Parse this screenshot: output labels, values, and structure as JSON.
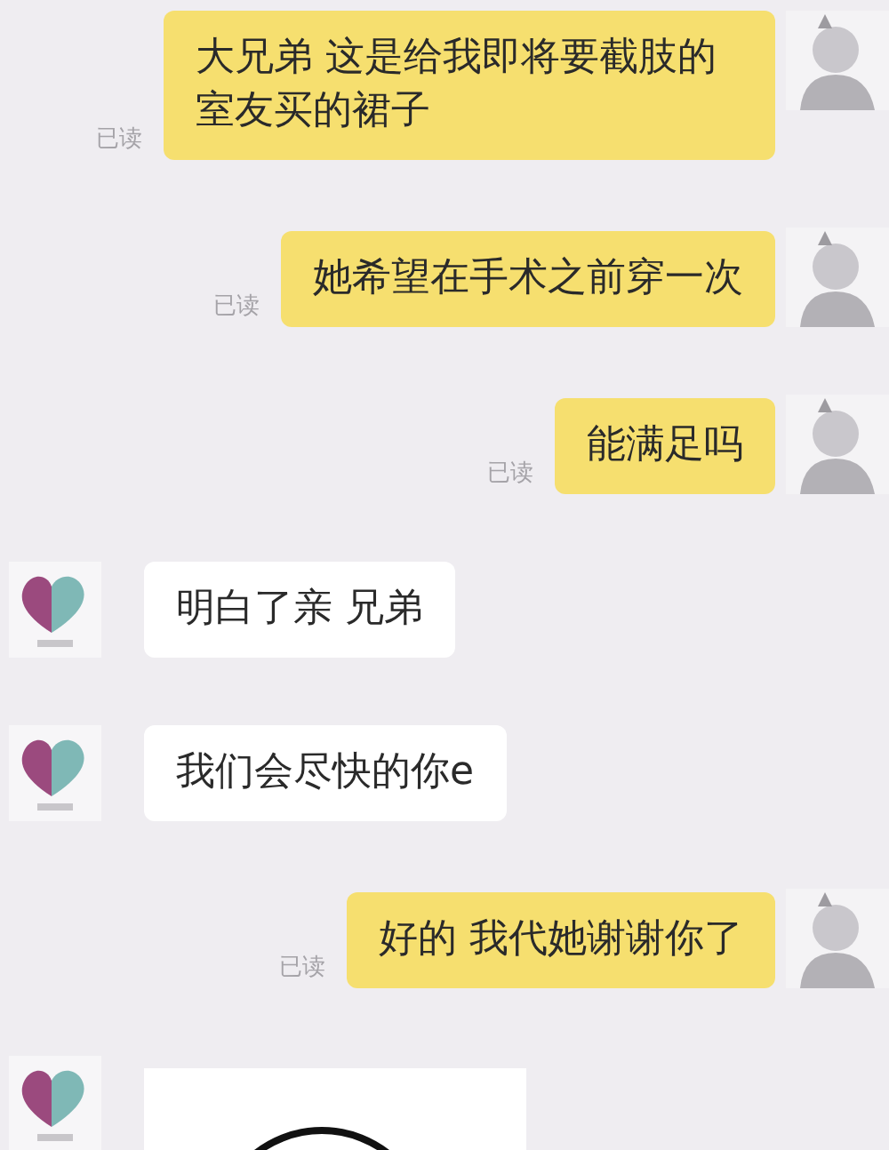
{
  "messages": [
    {
      "kind": "text",
      "outgoing": true,
      "text": "大兄弟 这是给我即将要截肢的室友买的裙子",
      "status": "已读"
    },
    {
      "kind": "text",
      "outgoing": true,
      "text": "她希望在手术之前穿一次",
      "status": "已读"
    },
    {
      "kind": "text",
      "outgoing": true,
      "text": "能满足吗",
      "status": "已读"
    },
    {
      "kind": "text",
      "outgoing": false,
      "text": "明白了亲 兄弟"
    },
    {
      "kind": "text",
      "outgoing": false,
      "text": "我们会尽快的你e"
    },
    {
      "kind": "text",
      "outgoing": true,
      "text": "好的 我代她谢谢你了",
      "status": "已读"
    },
    {
      "kind": "image",
      "outgoing": false
    }
  ]
}
